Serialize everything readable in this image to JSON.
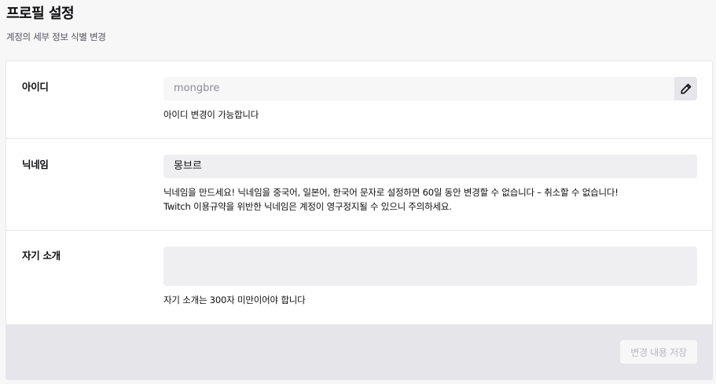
{
  "header": {
    "title": "프로필 설정",
    "subtitle": "계정의 세부 정보 식별 변경"
  },
  "username": {
    "label": "아이디",
    "value": "mongbre",
    "help": "아이디 변경이 가능합니다",
    "edit_icon": "pencil-icon"
  },
  "nickname": {
    "label": "닉네임",
    "value": "몽브르",
    "help_line1": "닉네임을 만드세요! 닉네임을 중국어, 일본어, 한국어 문자로 설정하면 60일 동안 변경할 수 없습니다 – 취소할 수 없습니다!",
    "help_line2": "Twitch 이용규약을 위반한 닉네임은 계정이 영구정지될 수 있으니 주의하세요."
  },
  "bio": {
    "label": "자기 소개",
    "value": "",
    "help": "자기 소개는 300자 미만이어야 합니다"
  },
  "footer": {
    "save_label": "변경 내용 저장"
  }
}
